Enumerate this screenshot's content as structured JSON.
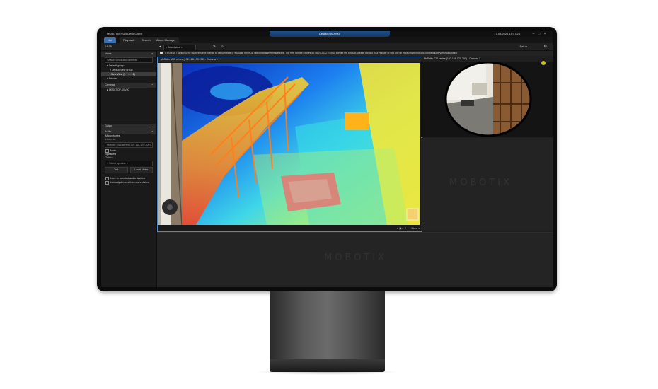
{
  "window": {
    "app_title": "MOBOTIX HUB Desk Client",
    "center_tab": "Desktop (00V90)",
    "clock": "17.03.2021 15:47:24"
  },
  "tabs": [
    "Live",
    "Playback",
    "Search",
    "Alarm Manager"
  ],
  "toolbar": {
    "time": "14:35",
    "view_select": "< Select view >",
    "setup_label": "Setup"
  },
  "sidebar": {
    "views_title": "Views",
    "search_placeholder": "Search views and cameras",
    "tree": [
      "Default group",
      "Default view group",
      "New View (1 + 1 + 2)",
      "Private"
    ],
    "cameras_title": "Cameras",
    "camera_item": "DESKTOP-00V90",
    "output_title": "Output",
    "audio_title": "Audio",
    "microphones_label": "Microphones",
    "listen_to_label": "Listen to:",
    "listen_to_value": "Mobotix M15 series (192.168.170.200) - Microphone",
    "mute_label": "Mute",
    "speakers_label": "Speakers",
    "talk_to_label": "Talk to:",
    "talk_to_value": "< Select speaker >",
    "talk_button": "Talk",
    "level_meter_button": "Level Meter",
    "lock_label": "Lock to selected audio devices",
    "list_label": "List only devices from current view"
  },
  "main": {
    "notice": "SYSTEM: Thank you for using this free license to demonstrate or evaluate the HUB video management software. The free license expires on 08.07.2022. To buy license the product, please contact your reseller or find one on https://www.mobotix.com/products/vms/mobotixhub",
    "camera1_title": "MxSoftv M15 series (192.168.170.200) - Camera 1",
    "camera2_title": "MxSoftv T26 series (192.168.170.201) - Camera 1",
    "watermark": "MOBOTIX",
    "playback_label": "Mono"
  },
  "colors": {
    "accent": "#3a6fb0",
    "bezel": "#0b0b0b",
    "screen_bg": "#1c1c1c"
  }
}
